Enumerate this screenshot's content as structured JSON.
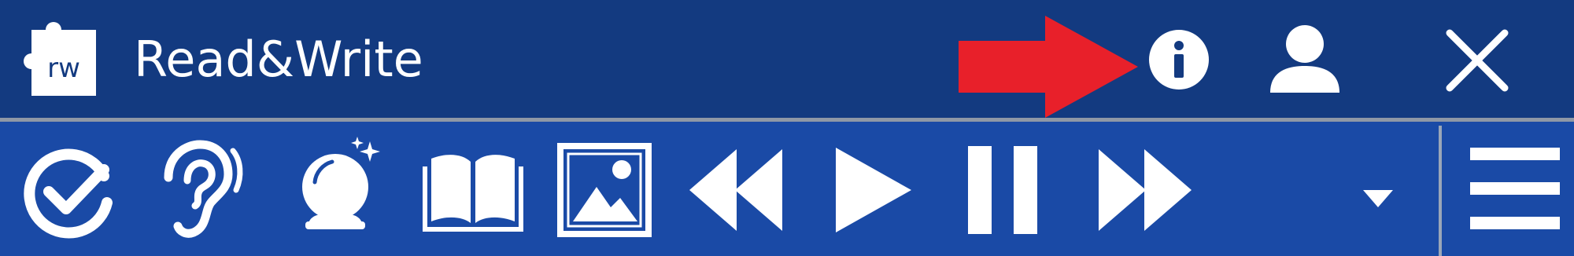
{
  "app": {
    "title": "Read&Write",
    "logo_text": "rw",
    "colors": {
      "titlebar": "#133a80",
      "toolbar": "#1a4aa6",
      "icon": "#ffffff",
      "annotation_arrow": "#e8202a"
    }
  },
  "titlebar_buttons": [
    {
      "icon": "info-icon"
    },
    {
      "icon": "user-icon"
    },
    {
      "icon": "close-icon"
    }
  ],
  "toolbar": {
    "tools": [
      {
        "icon": "check-it-icon"
      },
      {
        "icon": "ear-icon"
      },
      {
        "icon": "crystal-ball-icon"
      },
      {
        "icon": "book-icon"
      },
      {
        "icon": "picture-icon"
      },
      {
        "icon": "rewind-icon"
      },
      {
        "icon": "play-icon"
      },
      {
        "icon": "pause-icon"
      },
      {
        "icon": "fast-forward-icon"
      }
    ],
    "more": {
      "icon": "chevron-down-icon"
    },
    "menu": {
      "icon": "hamburger-menu-icon"
    }
  },
  "annotation": {
    "icon": "red-arrow-icon"
  }
}
